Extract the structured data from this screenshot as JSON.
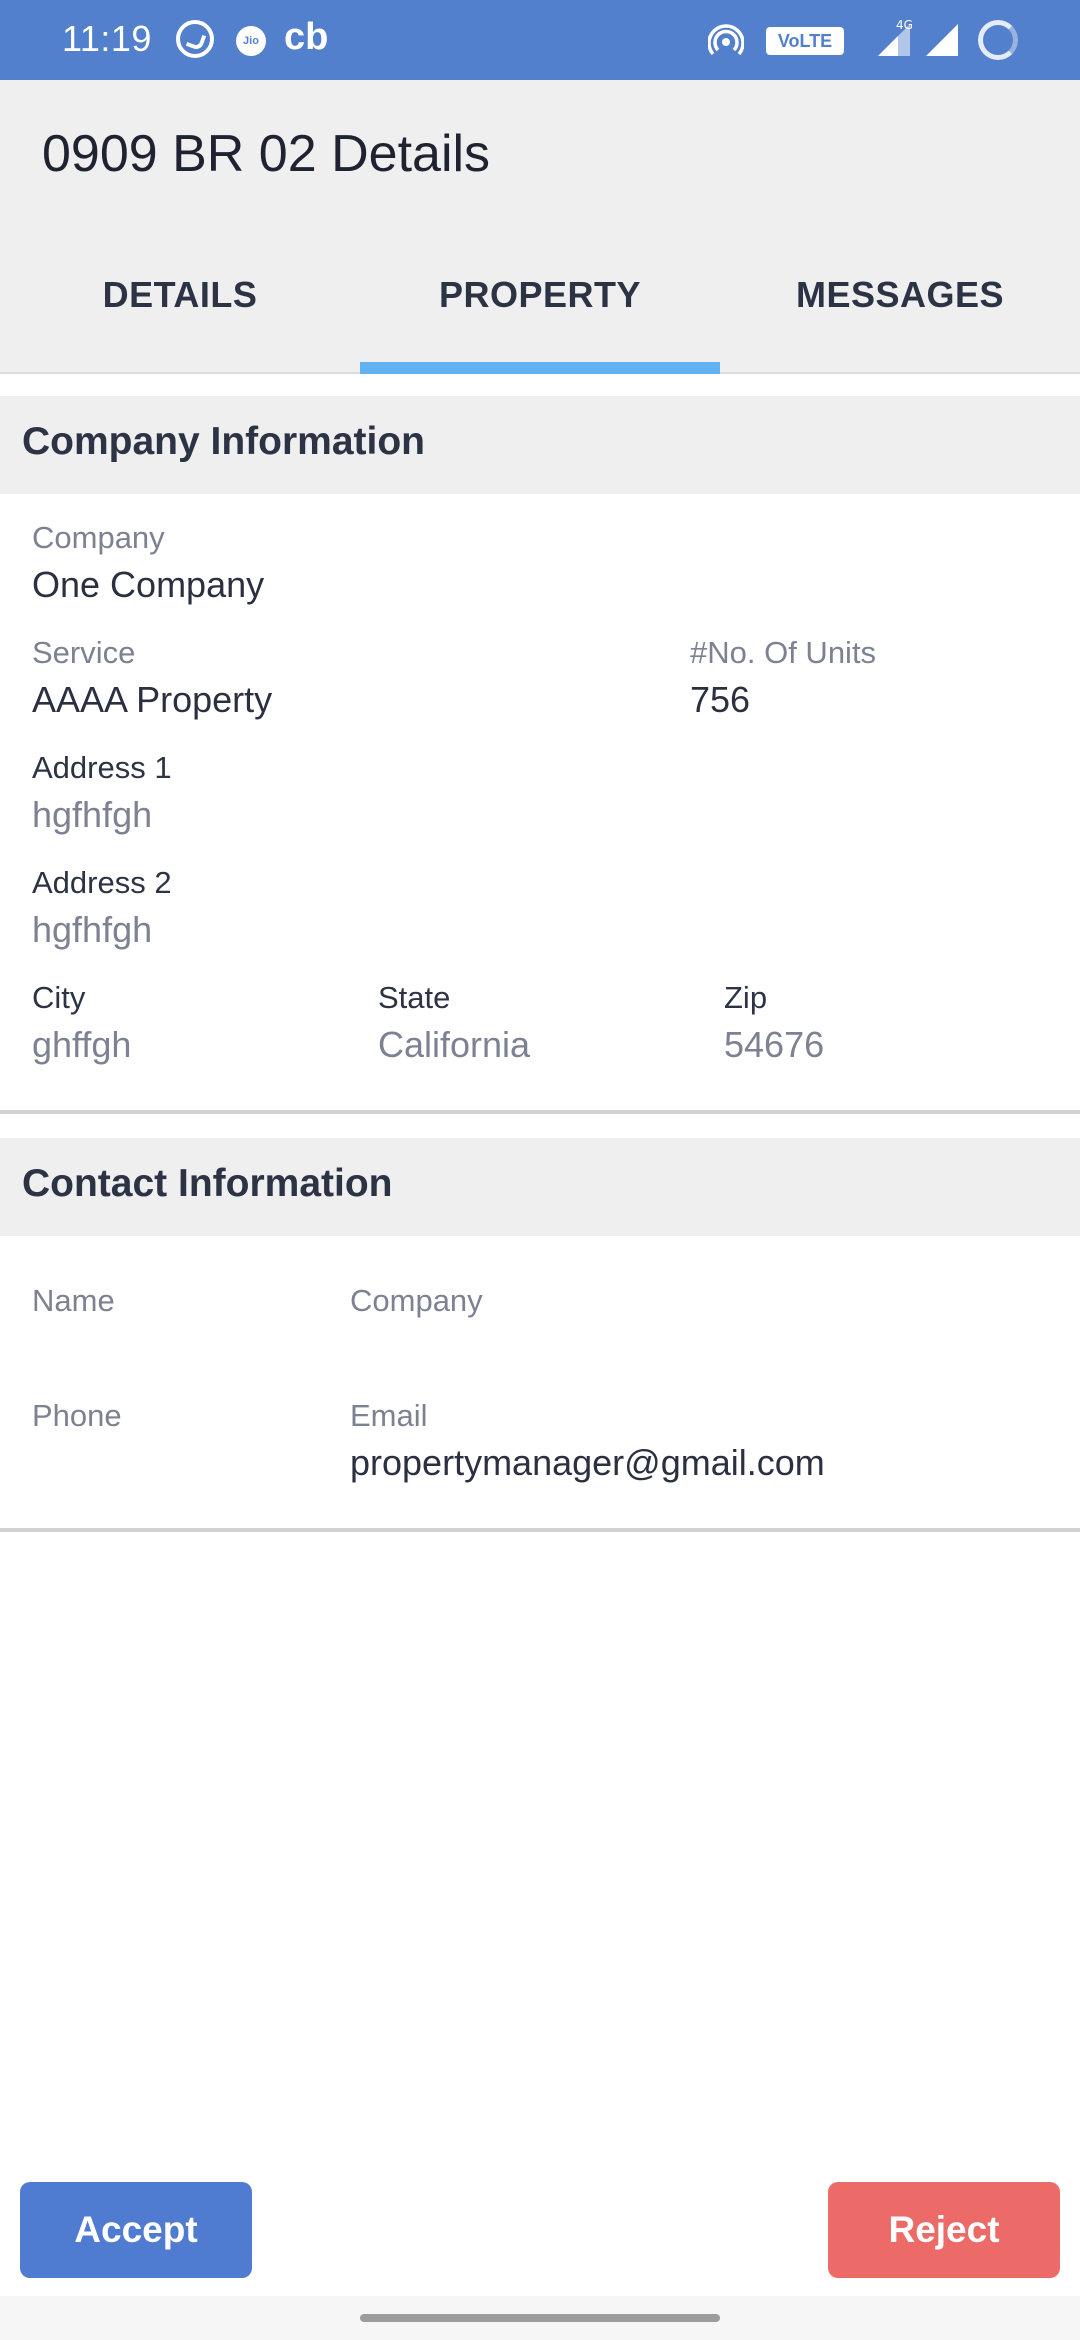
{
  "status_bar": {
    "time": "11:19",
    "volte_label": "VoLTE",
    "network_label": "4G",
    "icons": [
      "whatsapp-icon",
      "jio-icon",
      "cb-icon",
      "hotspot-icon",
      "volte-icon",
      "data-arrows-icon",
      "signal-icon",
      "signal-icon",
      "battery-icon"
    ]
  },
  "header": {
    "title": "0909 BR 02 Details"
  },
  "tabs": [
    {
      "label": "DETAILS",
      "active": false
    },
    {
      "label": "PROPERTY",
      "active": true
    },
    {
      "label": "MESSAGES",
      "active": false
    }
  ],
  "company_section": {
    "heading": "Company Information",
    "company_label": "Company",
    "company_value": "One Company",
    "service_label": "Service",
    "service_value": "AAAA Property",
    "units_label": "#No. Of Units",
    "units_value": "756",
    "address1_label": "Address 1",
    "address1_value": "hgfhfgh",
    "address2_label": "Address 2",
    "address2_value": "hgfhfgh",
    "city_label": "City",
    "city_value": "ghffgh",
    "state_label": "State",
    "state_value": "California",
    "zip_label": "Zip",
    "zip_value": "54676"
  },
  "contact_section": {
    "heading": "Contact Information",
    "name_label": "Name",
    "company_label": "Company",
    "phone_label": "Phone",
    "email_label": "Email",
    "email_value": "propertymanager@gmail.com"
  },
  "actions": {
    "accept_label": "Accept",
    "reject_label": "Reject"
  },
  "colors": {
    "status_bar": "#5380cc",
    "tab_indicator": "#62b1f1",
    "accept": "#4f7bd0",
    "reject": "#ec6b68"
  }
}
